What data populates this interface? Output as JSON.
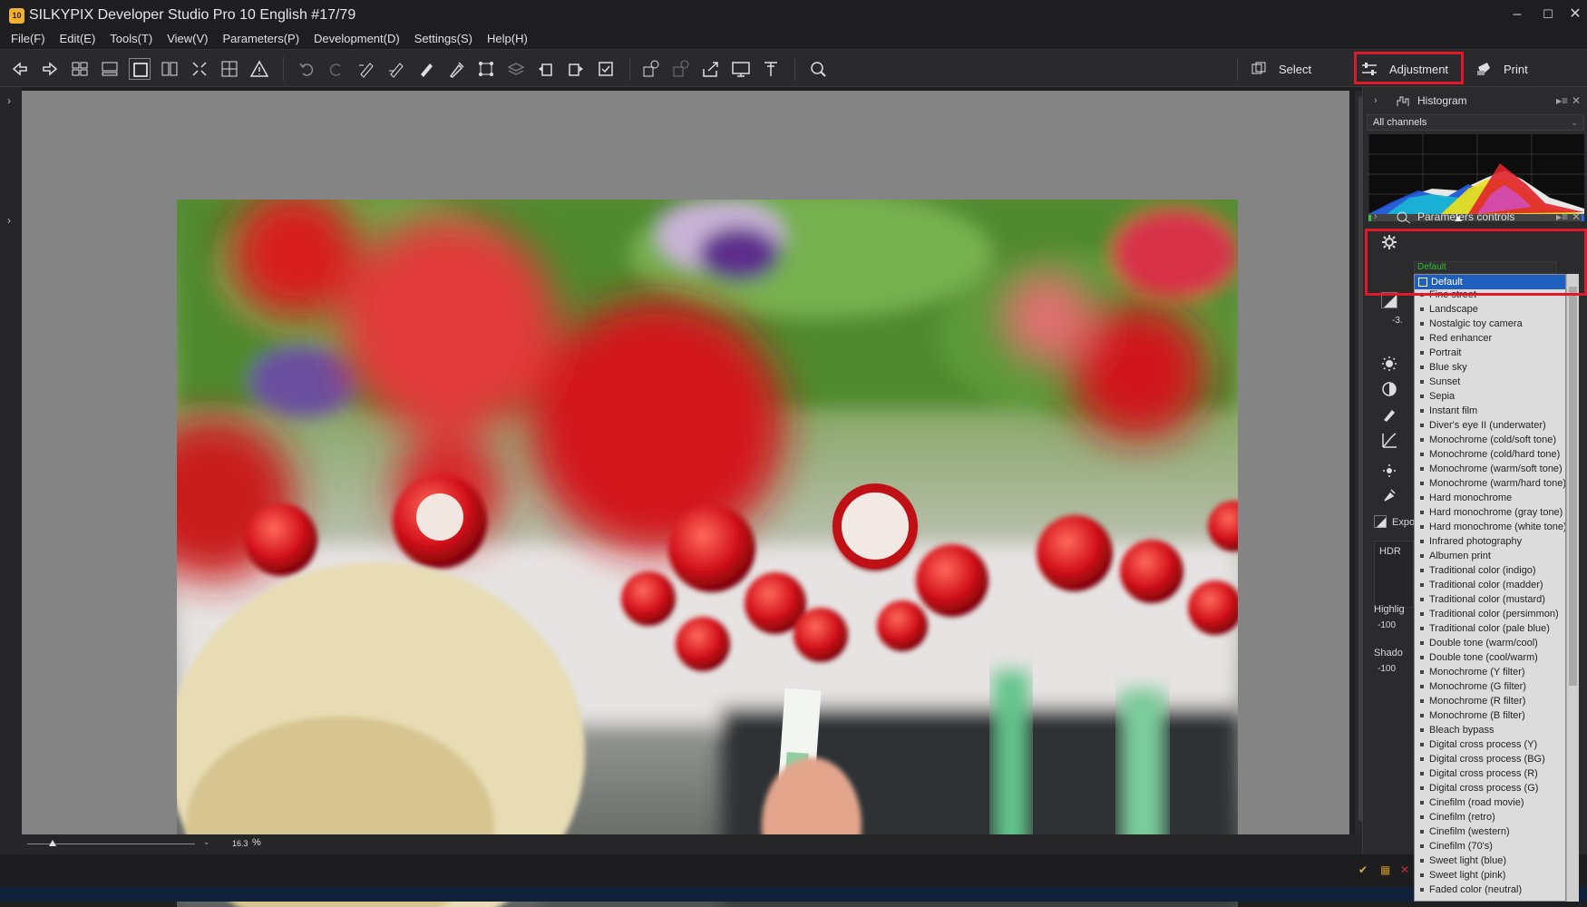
{
  "window": {
    "app_icon_text": "10",
    "title": "SILKYPIX Developer Studio Pro 10 English   #17/79",
    "minimize": "–",
    "maximize": "☐",
    "close": "✕"
  },
  "menu": [
    "File(F)",
    "Edit(E)",
    "Tools(T)",
    "View(V)",
    "Parameters(P)",
    "Development(D)",
    "Settings(S)",
    "Help(H)"
  ],
  "modes": {
    "select": "Select",
    "adjustment": "Adjustment",
    "print": "Print"
  },
  "status": {
    "zoom_value": "16.3",
    "zoom_unit": "%"
  },
  "histogram_panel": {
    "title": "Histogram",
    "channel": "All channels"
  },
  "parameters_panel": {
    "title": "Parameters controls",
    "preset_current": "Default"
  },
  "side_labels": {
    "exposure_value": "-3.",
    "exposure": "Expo",
    "hdr": "HDR",
    "highlight": "Highlig",
    "highlight_value": "-100",
    "shadow": "Shado",
    "shadow_value": "-100"
  },
  "preset_list": {
    "selected": "Default",
    "items": [
      "Fine street",
      "Landscape",
      "Nostalgic toy camera",
      "Red enhancer",
      "Portrait",
      "Blue sky",
      "Sunset",
      "Sepia",
      "Instant film",
      "Diver's eye II (underwater)",
      "Monochrome (cold/soft tone)",
      "Monochrome (cold/hard tone)",
      "Monochrome (warm/soft tone)",
      "Monochrome (warm/hard tone)",
      "Hard monochrome",
      "Hard monochrome (gray tone)",
      "Hard monochrome (white tone)",
      "Infrared photography",
      "Albumen print",
      "Traditional color (indigo)",
      "Traditional color (madder)",
      "Traditional color (mustard)",
      "Traditional color (persimmon)",
      "Traditional color (pale blue)",
      "Double tone (warm/cool)",
      "Double tone (cool/warm)",
      "Monochrome (Y filter)",
      "Monochrome (G filter)",
      "Monochrome (R filter)",
      "Monochrome (B filter)",
      "Bleach bypass",
      "Digital cross process (Y)",
      "Digital cross process (BG)",
      "Digital cross process (R)",
      "Digital cross process (G)",
      "Cinefilm (road movie)",
      "Cinefilm (retro)",
      "Cinefilm (western)",
      "Cinefilm (70's)",
      "Sweet light (blue)",
      "Sweet light (pink)",
      "Faded color (neutral)"
    ]
  },
  "colors": {
    "highlight_box": "#e0192a",
    "selection": "#1f5fbd",
    "preset_text": "#2bbd2b"
  }
}
